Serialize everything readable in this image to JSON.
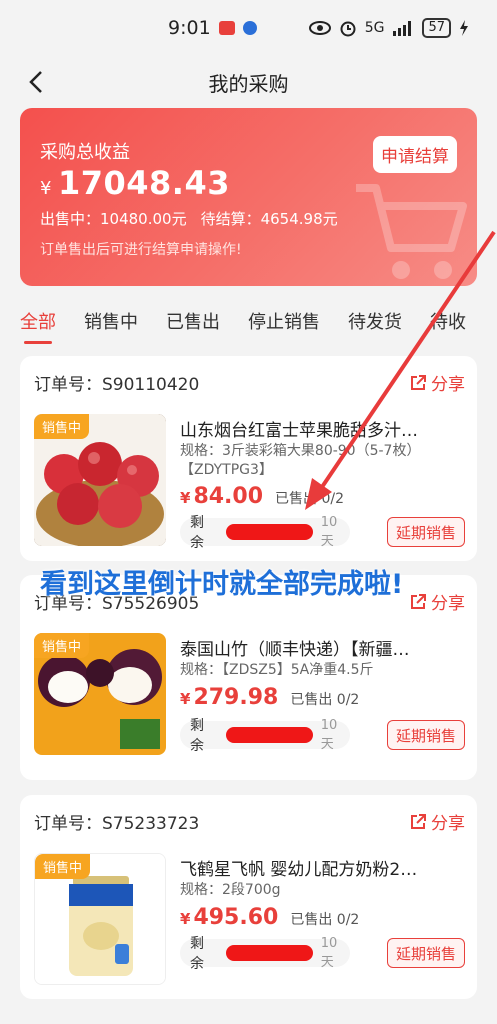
{
  "status_bar": {
    "time": "9:01",
    "signal": "5G",
    "battery": "57"
  },
  "nav": {
    "title": "我的采购"
  },
  "banner": {
    "title": "采购总收益",
    "currency": "¥",
    "amount": "17048.43",
    "sold_label": "出售中：10480.00元",
    "pending_label": "待结算：4654.98元",
    "note": "订单售出后可进行结算申请操作!",
    "settle_button": "申请结算"
  },
  "tabs": [
    "全部",
    "销售中",
    "已售出",
    "停止销售",
    "待发货",
    "待收"
  ],
  "orders": [
    {
      "order_label": "订单号：",
      "order_no": "S90110420",
      "share": "分享",
      "badge": "销售中",
      "name": "山东烟台红富士苹果脆甜多汁…",
      "spec": "规格：3斤装彩箱大果80-90（5-7枚）【ZDYTPG3】",
      "currency": "¥",
      "price": "84.00",
      "sold": "已售出 0/2",
      "remain_label": "剩余",
      "days": "10天",
      "extend": "延期销售"
    },
    {
      "order_label": "订单号：",
      "order_no": "S75526905",
      "share": "分享",
      "badge": "销售中",
      "name": "泰国山竹（顺丰快递）【新疆…",
      "spec": "规格：【ZDSZ5】5A净重4.5斤",
      "currency": "¥",
      "price": "279.98",
      "sold": "已售出 0/2",
      "remain_label": "剩余",
      "days": "10天",
      "extend": "延期销售"
    },
    {
      "order_label": "订单号：",
      "order_no": "S75233723",
      "share": "分享",
      "badge": "销售中",
      "name": "飞鹤星飞帆 婴幼儿配方奶粉2…",
      "spec": "规格：2段700g",
      "currency": "¥",
      "price": "495.60",
      "sold": "已售出 0/2",
      "remain_label": "剩余",
      "days": "10天",
      "extend": "延期销售"
    }
  ],
  "annotation": {
    "text": "看到这里倒计时就全部完成啦!",
    "color": "#1e6fd8"
  },
  "colors": {
    "accent": "#e8403b",
    "badge": "#f7a521",
    "countdown_bar": "#ef1717"
  }
}
